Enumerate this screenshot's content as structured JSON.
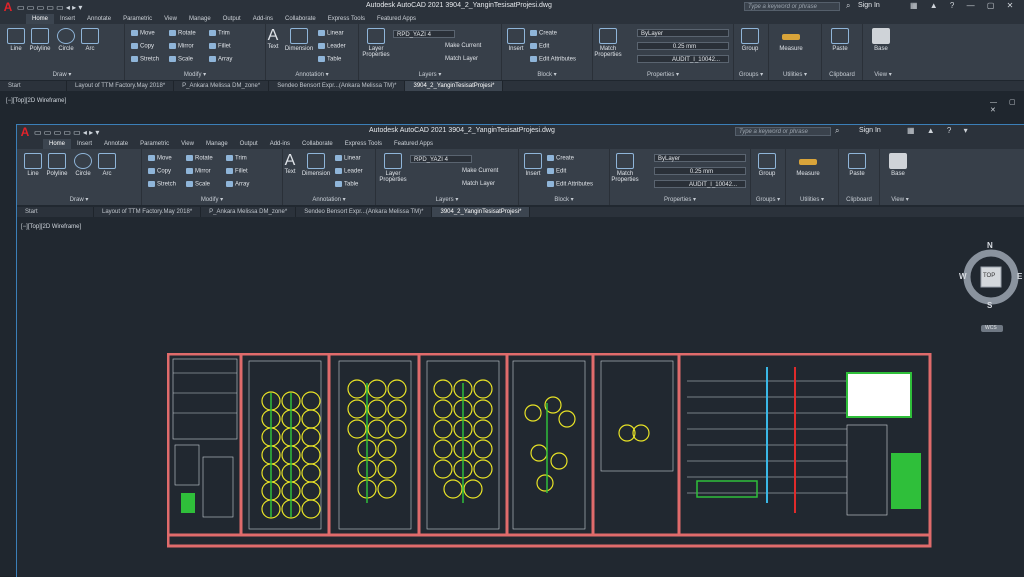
{
  "app": {
    "title": "Autodesk AutoCAD 2021    3904_2_YanginTesisatProjesi.dwg",
    "search_placeholder": "Type a keyword or phrase",
    "signin": "Sign In"
  },
  "ribbon_tabs": [
    "Home",
    "Insert",
    "Annotate",
    "Parametric",
    "View",
    "Manage",
    "Output",
    "Add-ins",
    "Collaborate",
    "Express Tools",
    "Featured Apps"
  ],
  "back_ribbon_tabs": [
    "Home",
    "Insert",
    "Annotate",
    "Parametric",
    "View",
    "Manage",
    "Output",
    "Add-ins",
    "Collaborate",
    "Express Tools",
    "Featured Apps"
  ],
  "panels": {
    "draw": {
      "label": "Draw ▾",
      "line": "Line",
      "polyline": "Polyline",
      "circle": "Circle",
      "arc": "Arc"
    },
    "modify": {
      "label": "Modify ▾",
      "move": "Move",
      "rotate": "Rotate",
      "trim": "Trim",
      "copy": "Copy",
      "mirror": "Mirror",
      "fillet": "Fillet",
      "stretch": "Stretch",
      "scale": "Scale",
      "array": "Array"
    },
    "annotation": {
      "label": "Annotation ▾",
      "text": "Text",
      "dimension": "Dimension",
      "linear": "Linear",
      "leader": "Leader",
      "table": "Table"
    },
    "layers": {
      "label": "Layers ▾",
      "layer_props": "Layer Properties",
      "current_layer": "RPD_YAZI 4",
      "make_current": "Make Current",
      "match_layer": "Match Layer"
    },
    "block": {
      "label": "Block ▾",
      "insert": "Insert",
      "create": "Create",
      "edit": "Edit",
      "edit_attributes": "Edit Attributes"
    },
    "properties": {
      "label": "Properties ▾",
      "match_props": "Match Properties",
      "color": "ByLayer",
      "lineweight": "0.25 mm",
      "linetype": "AUDIT_I_10042..."
    },
    "groups": {
      "label": "Groups ▾",
      "group": "Group"
    },
    "utilities": {
      "label": "Utilities ▾",
      "measure": "Measure"
    },
    "clipboard": {
      "label": "Clipboard",
      "paste": "Paste"
    },
    "view": {
      "label": "View ▾",
      "base": "Base"
    }
  },
  "doc_tabs": [
    "Start",
    "Layout of TTM Factory.May 2018*",
    "P_Ankara Melissa DM_zone*",
    "Sendeo Bensort Expr...(Ankara Melissa TM)*",
    "3904_2_YanginTesisatProjesi*"
  ],
  "back_doc_tabs": [
    "Start",
    "Layout of TTM Factory.May 2018*",
    "P_Ankara Melissa DM_zone*",
    "Sendeo Bensort Expr...(Ankara Melissa TM)*",
    "3904_2_YanginTesisatProjesi*"
  ],
  "viewport_label": "[−][Top][2D Wireframe]",
  "viewcube": {
    "n": "N",
    "s": "S",
    "e": "E",
    "w": "W",
    "top": "TOP",
    "wcs": "WCS"
  },
  "colors": {
    "accent": "#e06b6b",
    "bg": "#212830",
    "ribbon": "#373f49"
  }
}
